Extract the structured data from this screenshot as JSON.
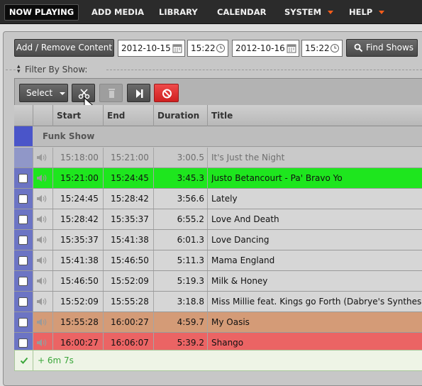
{
  "nav": {
    "items": [
      {
        "label": "NOW PLAYING"
      },
      {
        "label": "ADD MEDIA"
      },
      {
        "label": "LIBRARY"
      },
      {
        "label": "CALENDAR"
      },
      {
        "label": "SYSTEM"
      },
      {
        "label": "HELP"
      }
    ]
  },
  "controls": {
    "add_remove_label": "Add / Remove Content",
    "start_date": "2012-10-15",
    "start_time": "15:22",
    "end_date": "2012-10-16",
    "end_time": "15:22",
    "find_shows_label": "Find Shows"
  },
  "filter": {
    "label": "Filter By Show:"
  },
  "toolbar": {
    "select_label": "Select"
  },
  "table": {
    "columns": [
      "Start",
      "End",
      "Duration",
      "Title"
    ],
    "show_name": "Funk Show",
    "rows": [
      {
        "start": "15:18:00",
        "end": "15:21:00",
        "duration": "3:00.5",
        "title": "It's Just the Night",
        "state": "past"
      },
      {
        "start": "15:21:00",
        "end": "15:24:45",
        "duration": "3:45.3",
        "title": "Justo Betancourt - Pa' Bravo Yo",
        "state": "playing"
      },
      {
        "start": "15:24:45",
        "end": "15:28:42",
        "duration": "3:56.6",
        "title": "Lately",
        "state": "normal"
      },
      {
        "start": "15:28:42",
        "end": "15:35:37",
        "duration": "6:55.2",
        "title": "Love And Death",
        "state": "normal"
      },
      {
        "start": "15:35:37",
        "end": "15:41:38",
        "duration": "6:01.3",
        "title": "Love Dancing",
        "state": "normal"
      },
      {
        "start": "15:41:38",
        "end": "15:46:50",
        "duration": "5:11.3",
        "title": "Mama England",
        "state": "normal"
      },
      {
        "start": "15:46:50",
        "end": "15:52:09",
        "duration": "5:19.3",
        "title": "Milk & Honey",
        "state": "normal"
      },
      {
        "start": "15:52:09",
        "end": "15:55:28",
        "duration": "3:18.8",
        "title": "Miss Millie feat. Kings go Forth (Dabrye's Synthesiz",
        "state": "normal"
      },
      {
        "start": "15:55:28",
        "end": "16:00:27",
        "duration": "4:59.7",
        "title": "My Oasis",
        "state": "overlap"
      },
      {
        "start": "16:00:27",
        "end": "16:06:07",
        "duration": "5:39.2",
        "title": "Shango",
        "state": "over"
      }
    ],
    "footer": "+ 6m 7s"
  },
  "colors": {
    "playing": "#1ee61e",
    "overlap": "#d49b77",
    "over": "#eb6464",
    "checkbox_column": "#6c74c4",
    "footer_text": "#3aa63a"
  }
}
